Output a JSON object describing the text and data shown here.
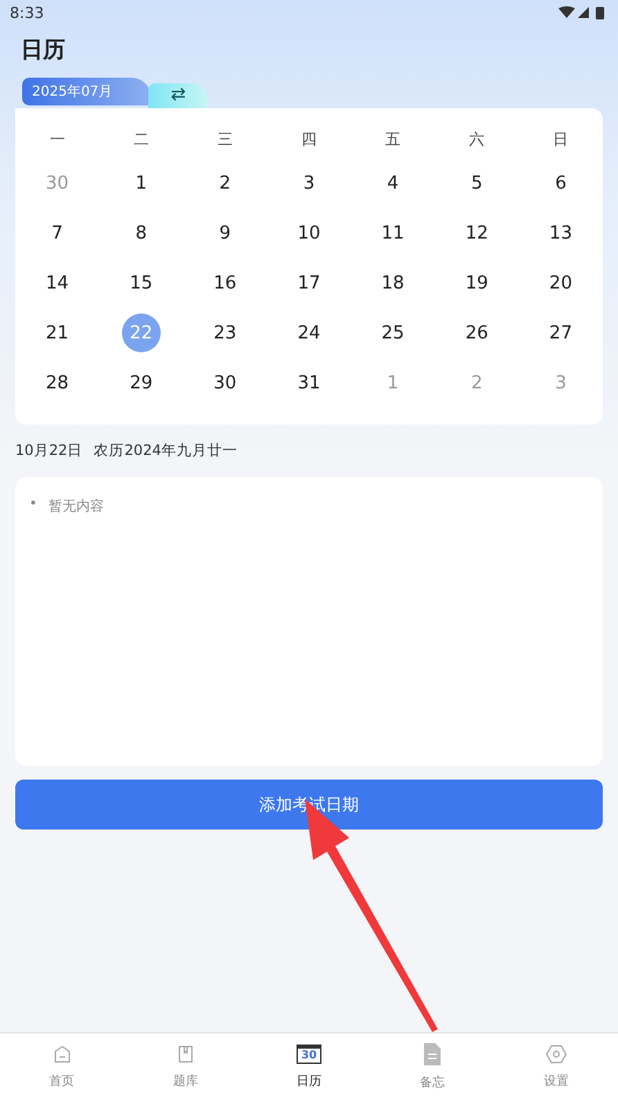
{
  "status_bar": {
    "time": "8:33"
  },
  "title": "日历",
  "calendar": {
    "month": "2025年07月",
    "swap_icon": "⇄",
    "weekdays": [
      "一",
      "二",
      "三",
      "四",
      "五",
      "六",
      "日"
    ],
    "days": [
      {
        "label": "30",
        "muted": true,
        "selected": false
      },
      {
        "label": "1",
        "muted": false,
        "selected": false
      },
      {
        "label": "2",
        "muted": false,
        "selected": false
      },
      {
        "label": "3",
        "muted": false,
        "selected": false
      },
      {
        "label": "4",
        "muted": false,
        "selected": false
      },
      {
        "label": "5",
        "muted": false,
        "selected": false
      },
      {
        "label": "6",
        "muted": false,
        "selected": false
      },
      {
        "label": "7",
        "muted": false,
        "selected": false
      },
      {
        "label": "8",
        "muted": false,
        "selected": false
      },
      {
        "label": "9",
        "muted": false,
        "selected": false
      },
      {
        "label": "10",
        "muted": false,
        "selected": false
      },
      {
        "label": "11",
        "muted": false,
        "selected": false
      },
      {
        "label": "12",
        "muted": false,
        "selected": false
      },
      {
        "label": "13",
        "muted": false,
        "selected": false
      },
      {
        "label": "14",
        "muted": false,
        "selected": false
      },
      {
        "label": "15",
        "muted": false,
        "selected": false
      },
      {
        "label": "16",
        "muted": false,
        "selected": false
      },
      {
        "label": "17",
        "muted": false,
        "selected": false
      },
      {
        "label": "18",
        "muted": false,
        "selected": false
      },
      {
        "label": "19",
        "muted": false,
        "selected": false
      },
      {
        "label": "20",
        "muted": false,
        "selected": false
      },
      {
        "label": "21",
        "muted": false,
        "selected": false
      },
      {
        "label": "22",
        "muted": false,
        "selected": true
      },
      {
        "label": "23",
        "muted": false,
        "selected": false
      },
      {
        "label": "24",
        "muted": false,
        "selected": false
      },
      {
        "label": "25",
        "muted": false,
        "selected": false
      },
      {
        "label": "26",
        "muted": false,
        "selected": false
      },
      {
        "label": "27",
        "muted": false,
        "selected": false
      },
      {
        "label": "28",
        "muted": false,
        "selected": false
      },
      {
        "label": "29",
        "muted": false,
        "selected": false
      },
      {
        "label": "30",
        "muted": false,
        "selected": false
      },
      {
        "label": "31",
        "muted": false,
        "selected": false
      },
      {
        "label": "1",
        "muted": true,
        "selected": false
      },
      {
        "label": "2",
        "muted": true,
        "selected": false
      },
      {
        "label": "3",
        "muted": true,
        "selected": false
      }
    ]
  },
  "date_info": {
    "date": "10月22日",
    "lunar": "农历2024年九月廿一"
  },
  "notes": {
    "bullet": "•",
    "empty_text": "暂无内容"
  },
  "add_button": "添加考试日期",
  "nav": [
    {
      "label": "首页",
      "kind": "home",
      "selected": false
    },
    {
      "label": "题库",
      "kind": "book",
      "selected": false
    },
    {
      "label": "日历",
      "kind": "calendar",
      "selected": true,
      "icon_text": "30"
    },
    {
      "label": "备忘",
      "kind": "memo",
      "selected": false
    },
    {
      "label": "设置",
      "kind": "settings",
      "selected": false
    }
  ]
}
